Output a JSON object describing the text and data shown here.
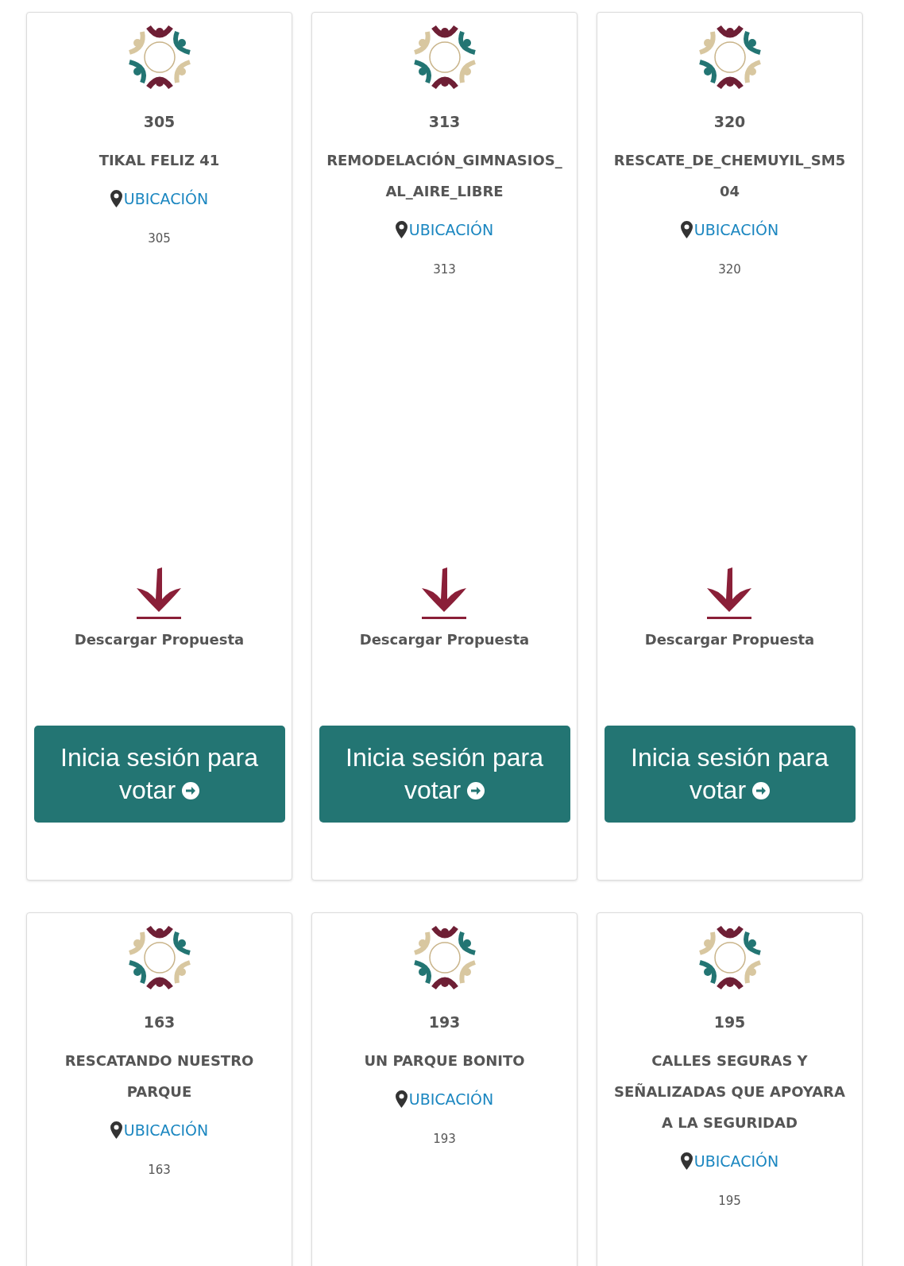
{
  "cards": [
    {
      "number": "305",
      "title": "TIKAL FELIZ 41",
      "location_link": "UBICACIÓN",
      "code": "305",
      "download": "Descargar Propuesta",
      "vote_button": {
        "text": "Inicia sesión para votar"
      }
    },
    {
      "number": "313",
      "title": "REMODELACIÓN_GIMNASIOS_AL_AIRE_LIBRE",
      "location_link": "UBICACIÓN",
      "code": "313",
      "download": "Descargar Propuesta",
      "vote_button": {
        "text": "Inicia sesión para votar"
      }
    },
    {
      "number": "320",
      "title": "RESCATE_DE_CHEMUYIL_SM504",
      "location_link": "UBICACIÓN",
      "code": "320",
      "download": "Descargar Propuesta",
      "vote_button": {
        "text": "Inicia sesión para votar"
      }
    },
    {
      "number": "163",
      "title": "RESCATANDO NUESTRO PARQUE",
      "location_link": "UBICACIÓN",
      "code": "163"
    },
    {
      "number": "193",
      "title": "UN PARQUE BONITO",
      "location_link": "UBICACIÓN",
      "code": "193"
    },
    {
      "number": "195",
      "title": "CALLES SEGURAS Y SEÑALIZADAS QUE APOYARA A LA SEGURIDAD",
      "location_link": "UBICACIÓN",
      "code": "195"
    }
  ]
}
